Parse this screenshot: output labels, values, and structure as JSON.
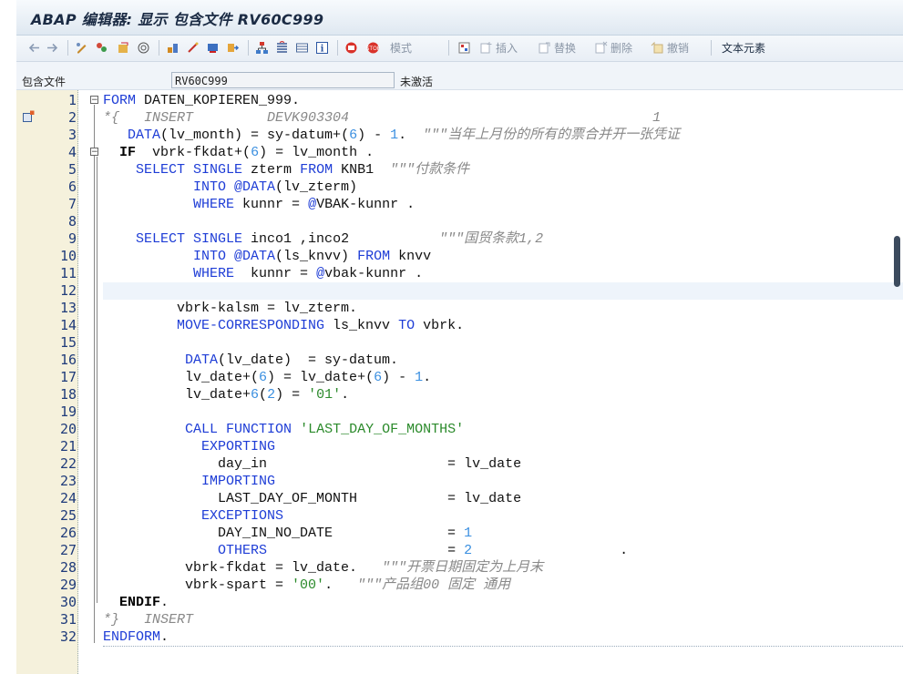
{
  "window": {
    "title": "ABAP 编辑器: 显示 包含文件 RV60C999"
  },
  "toolbar": {
    "mode_label": "模式",
    "insert_label": "插入",
    "replace_label": "替换",
    "delete_label": "删除",
    "undo_label": "撤销",
    "text_elements_label": "文本元素"
  },
  "header": {
    "include_label": "包含文件",
    "include_value": "RV60C999",
    "status": "未激活"
  },
  "editor": {
    "lines": [
      {
        "n": "1",
        "t": [
          [
            "kw",
            "FORM"
          ],
          [
            "id",
            " DATEN_KOPIEREN_999."
          ]
        ]
      },
      {
        "n": "2",
        "t": [
          [
            "cm",
            "*{   INSERT         DEVK903304                                     1"
          ]
        ]
      },
      {
        "n": "3",
        "t": [
          [
            "id",
            "   "
          ],
          [
            "kw",
            "DATA"
          ],
          [
            "id",
            "(lv_month) = sy-datum+("
          ],
          [
            "num",
            "6"
          ],
          [
            "id",
            ") - "
          ],
          [
            "num",
            "1"
          ],
          [
            "id",
            ".  "
          ],
          [
            "cm",
            "\"\"\"当年上月份的所有的票合并开一张凭证"
          ]
        ]
      },
      {
        "n": "4",
        "t": [
          [
            "id",
            "  "
          ],
          [
            "bd",
            "IF"
          ],
          [
            "id",
            "  vbrk-fkdat+("
          ],
          [
            "num",
            "6"
          ],
          [
            "id",
            ") = lv_month ."
          ]
        ]
      },
      {
        "n": "5",
        "t": [
          [
            "id",
            "    "
          ],
          [
            "kw",
            "SELECT SINGLE"
          ],
          [
            "id",
            " zterm "
          ],
          [
            "kw",
            "FROM"
          ],
          [
            "id",
            " KNB1  "
          ],
          [
            "cm",
            "\"\"\"付款条件"
          ]
        ]
      },
      {
        "n": "6",
        "t": [
          [
            "id",
            "           "
          ],
          [
            "kw",
            "INTO @DATA"
          ],
          [
            "id",
            "(lv_zterm)"
          ]
        ]
      },
      {
        "n": "7",
        "t": [
          [
            "id",
            "           "
          ],
          [
            "kw",
            "WHERE"
          ],
          [
            "id",
            " kunnr = "
          ],
          [
            "kw",
            "@"
          ],
          [
            "id",
            "VBAK-kunnr ."
          ]
        ]
      },
      {
        "n": "8",
        "t": []
      },
      {
        "n": "9",
        "t": [
          [
            "id",
            "    "
          ],
          [
            "kw",
            "SELECT SINGLE"
          ],
          [
            "id",
            " inco1 ,inco2           "
          ],
          [
            "cm",
            "\"\"\"国贸条款1,2"
          ]
        ]
      },
      {
        "n": "10",
        "t": [
          [
            "id",
            "           "
          ],
          [
            "kw",
            "INTO @DATA"
          ],
          [
            "id",
            "(ls_knvv) "
          ],
          [
            "kw",
            "FROM"
          ],
          [
            "id",
            " knvv"
          ]
        ]
      },
      {
        "n": "11",
        "t": [
          [
            "id",
            "           "
          ],
          [
            "kw",
            "WHERE"
          ],
          [
            "id",
            "  kunnr = "
          ],
          [
            "kw",
            "@"
          ],
          [
            "id",
            "vbak-kunnr ."
          ]
        ]
      },
      {
        "n": "12",
        "t": []
      },
      {
        "n": "13",
        "t": [
          [
            "id",
            "         vbrk-kalsm = lv_zterm."
          ]
        ]
      },
      {
        "n": "14",
        "t": [
          [
            "id",
            "         "
          ],
          [
            "kw",
            "MOVE-CORRESPONDING"
          ],
          [
            "id",
            " ls_knvv "
          ],
          [
            "kw",
            "TO"
          ],
          [
            "id",
            " vbrk."
          ]
        ]
      },
      {
        "n": "15",
        "t": []
      },
      {
        "n": "16",
        "t": [
          [
            "id",
            "          "
          ],
          [
            "kw",
            "DATA"
          ],
          [
            "id",
            "(lv_date)  = sy-datum."
          ]
        ]
      },
      {
        "n": "17",
        "t": [
          [
            "id",
            "          lv_date+("
          ],
          [
            "num",
            "6"
          ],
          [
            "id",
            ") = lv_date+("
          ],
          [
            "num",
            "6"
          ],
          [
            "id",
            ") - "
          ],
          [
            "num",
            "1"
          ],
          [
            "id",
            "."
          ]
        ]
      },
      {
        "n": "18",
        "t": [
          [
            "id",
            "          lv_date+"
          ],
          [
            "num",
            "6"
          ],
          [
            "id",
            "("
          ],
          [
            "num",
            "2"
          ],
          [
            "id",
            ") = "
          ],
          [
            "str",
            "'01'"
          ],
          [
            "id",
            "."
          ]
        ]
      },
      {
        "n": "19",
        "t": []
      },
      {
        "n": "20",
        "t": [
          [
            "id",
            "          "
          ],
          [
            "kw",
            "CALL FUNCTION"
          ],
          [
            "id",
            " "
          ],
          [
            "str",
            "'LAST_DAY_OF_MONTHS'"
          ]
        ]
      },
      {
        "n": "21",
        "t": [
          [
            "id",
            "            "
          ],
          [
            "kw",
            "EXPORTING"
          ]
        ]
      },
      {
        "n": "22",
        "t": [
          [
            "id",
            "              day_in                      = lv_date"
          ]
        ]
      },
      {
        "n": "23",
        "t": [
          [
            "id",
            "            "
          ],
          [
            "kw",
            "IMPORTING"
          ]
        ]
      },
      {
        "n": "24",
        "t": [
          [
            "id",
            "              LAST_DAY_OF_MONTH           = lv_date"
          ]
        ]
      },
      {
        "n": "25",
        "t": [
          [
            "id",
            "            "
          ],
          [
            "kw",
            "EXCEPTIONS"
          ]
        ]
      },
      {
        "n": "26",
        "t": [
          [
            "id",
            "              DAY_IN_NO_DATE              = "
          ],
          [
            "num",
            "1"
          ]
        ]
      },
      {
        "n": "27",
        "t": [
          [
            "id",
            "              "
          ],
          [
            "kw",
            "OTHERS"
          ],
          [
            "id",
            "                      = "
          ],
          [
            "num",
            "2"
          ],
          [
            "id",
            "                  ."
          ]
        ]
      },
      {
        "n": "28",
        "t": [
          [
            "id",
            "          vbrk-fkdat = lv_date.   "
          ],
          [
            "cm",
            "\"\"\"开票日期固定为上月末"
          ]
        ]
      },
      {
        "n": "29",
        "t": [
          [
            "id",
            "          vbrk-spart = "
          ],
          [
            "str",
            "'00'"
          ],
          [
            "id",
            ".   "
          ],
          [
            "cm",
            "\"\"\"产品组00 固定 通用"
          ]
        ]
      },
      {
        "n": "30",
        "t": [
          [
            "id",
            "  "
          ],
          [
            "bd",
            "ENDIF"
          ],
          [
            "id",
            "."
          ]
        ]
      },
      {
        "n": "31",
        "t": [
          [
            "cm",
            "*}   INSERT"
          ]
        ]
      },
      {
        "n": "32",
        "t": [
          [
            "kw",
            "ENDFORM"
          ],
          [
            "id",
            "."
          ]
        ]
      }
    ]
  }
}
